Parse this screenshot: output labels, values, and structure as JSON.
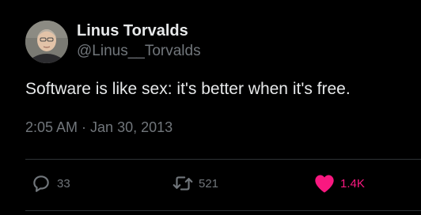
{
  "author": {
    "name": "Linus Torvalds",
    "handle": "@Linus__Torvalds"
  },
  "tweet": {
    "text": "Software is like sex: it's better when it's free.",
    "time": "2:05 AM",
    "separator": "·",
    "date": "Jan 30, 2013"
  },
  "actions": {
    "replies": "33",
    "retweets": "521",
    "likes": "1.4K",
    "liked": true
  },
  "colors": {
    "background": "#000000",
    "primary_text": "#e7e9ea",
    "secondary_text": "#71767b",
    "like_accent": "#f91880",
    "divider": "#2f3336"
  },
  "icons": {
    "reply": "speech-bubble-icon",
    "retweet": "retweet-arrows-icon",
    "like": "heart-filled-icon"
  }
}
